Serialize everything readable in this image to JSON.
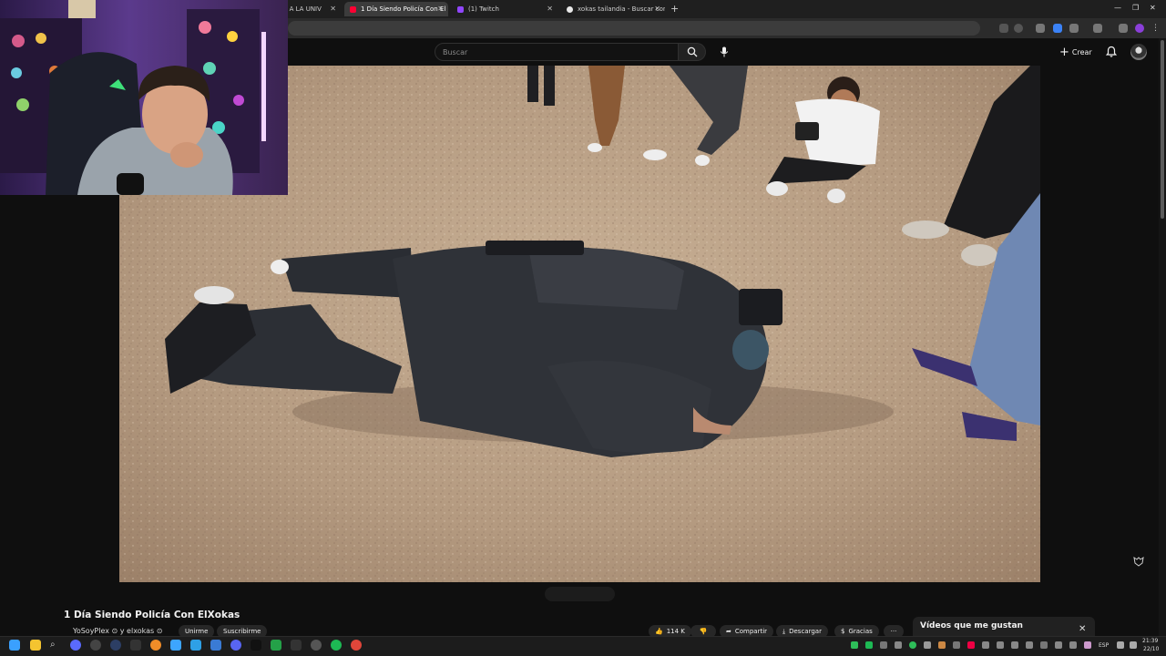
{
  "browser": {
    "tabs": [
      {
        "label": "KZ A LA UNIV",
        "active": false
      },
      {
        "label": "1 Día Siendo Policía Con El",
        "active": true
      },
      {
        "label": "(1) Twitch",
        "active": false
      },
      {
        "label": "xokas tailandia - Buscar con Go",
        "active": false
      }
    ]
  },
  "youtube": {
    "search_placeholder": "Buscar",
    "create_label": "Crear"
  },
  "video": {
    "title": "1 Día Siendo Policía Con ElXokas",
    "channel_line": "YoSoyPlex ⊙ y elxokas ⊙",
    "actions": {
      "join": "Unirme",
      "subscribe": "Suscribirme",
      "likes": "114 K",
      "share": "Compartir",
      "download": "Descargar",
      "thanks": "Gracias",
      "more": "···"
    }
  },
  "liked_panel": {
    "title": "Vídeos que me gustan",
    "close": "✕"
  },
  "taskbar": {
    "lang": "ESP",
    "time": "21:39",
    "date": "22/10"
  },
  "colors": {
    "youtube_bg": "#0f0f0f",
    "floor": "#b89e84",
    "suit": "#2f3238",
    "webcam_purple": "#5b3a8c"
  }
}
